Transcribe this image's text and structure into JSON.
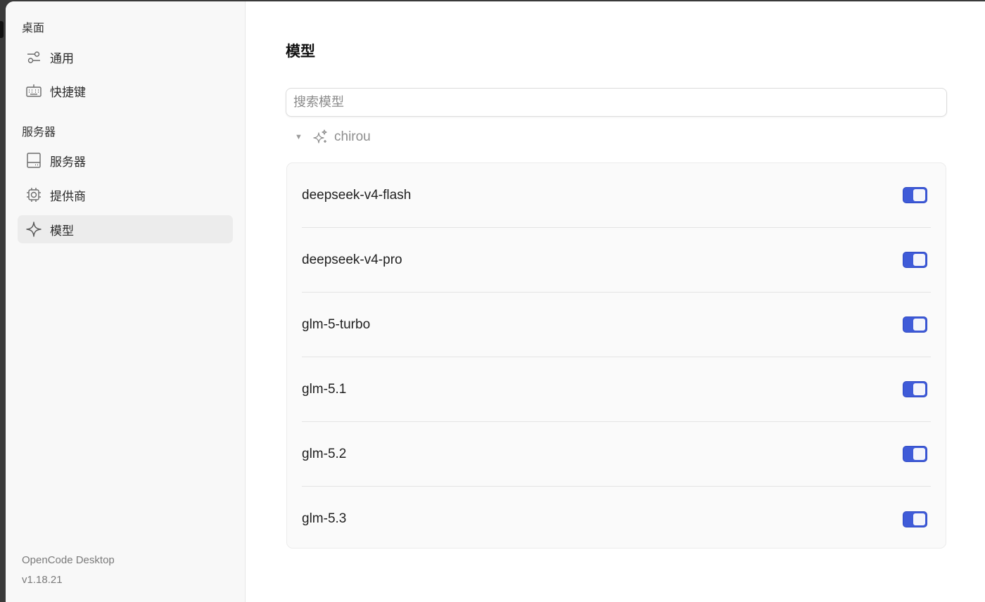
{
  "sidebar": {
    "section_desktop": "桌面",
    "section_server": "服务器",
    "items": [
      {
        "label": "通用",
        "icon": "sliders-icon"
      },
      {
        "label": "快捷键",
        "icon": "keyboard-icon"
      },
      {
        "label": "服务器",
        "icon": "server-icon"
      },
      {
        "label": "提供商",
        "icon": "chip-icon"
      },
      {
        "label": "模型",
        "icon": "sparkle-icon",
        "active": true
      }
    ],
    "footer": {
      "app_name": "OpenCode Desktop",
      "version": "v1.18.21"
    }
  },
  "main": {
    "title": "模型",
    "search": {
      "placeholder": "搜索模型",
      "value": ""
    },
    "provider": {
      "name": "chirou",
      "expanded": true
    },
    "models": [
      {
        "name": "deepseek-v4-flash",
        "enabled": true
      },
      {
        "name": "deepseek-v4-pro",
        "enabled": true
      },
      {
        "name": "glm-5-turbo",
        "enabled": true
      },
      {
        "name": "glm-5.1",
        "enabled": true
      },
      {
        "name": "glm-5.2",
        "enabled": true
      },
      {
        "name": "glm-5.3",
        "enabled": true
      }
    ]
  },
  "colors": {
    "accent": "#3f5bd8",
    "sidebar_bg": "#f8f8f8",
    "active_item_bg": "#ececec"
  }
}
